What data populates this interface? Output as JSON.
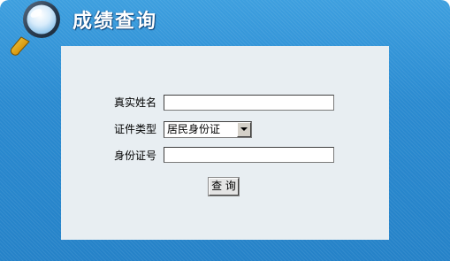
{
  "header": {
    "title": "成绩查询",
    "icon": "magnifier-icon"
  },
  "form": {
    "name_label": "真实姓名",
    "name_value": "",
    "id_type_label": "证件类型",
    "id_type_selected": "居民身份证",
    "id_number_label": "身份证号",
    "id_number_value": "",
    "submit_label": "查 询"
  },
  "colors": {
    "frame_blue": "#2f8fd0",
    "panel_bg": "#e8eef2",
    "title_text": "#ffffff"
  }
}
